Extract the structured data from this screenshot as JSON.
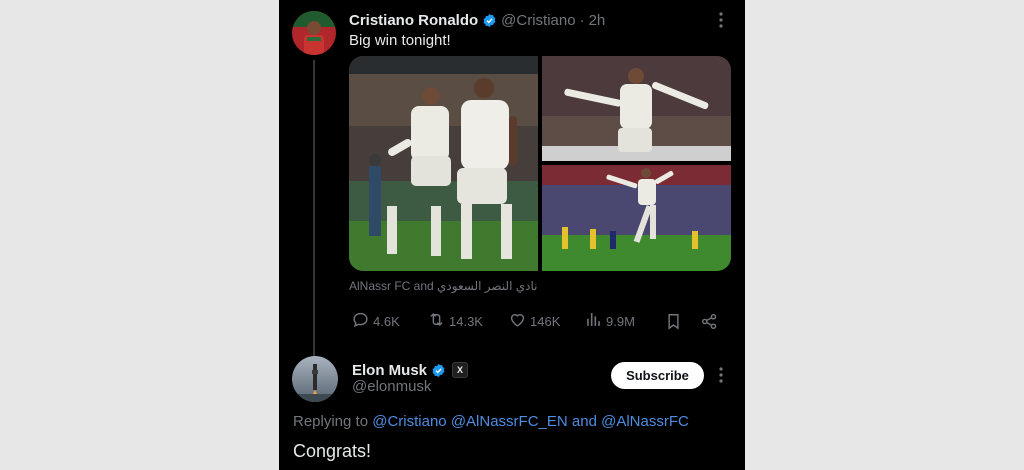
{
  "tweet": {
    "author_name": "Cristiano Ronaldo",
    "author_handle": "@Cristiano",
    "separator": "·",
    "time": "2h",
    "text": "Big win tonight!",
    "tagged": "AlNassr FC and نادي النصر السعودي",
    "stats": {
      "replies": "4.6K",
      "reposts": "14.3K",
      "likes": "146K",
      "views": "9.9M"
    }
  },
  "reply": {
    "author_name": "Elon Musk",
    "author_handle": "@elonmusk",
    "affiliate_badge": "X",
    "subscribe_label": "Subscribe",
    "replying_prefix": "Replying to",
    "mention_1": "@Cristiano",
    "mention_2": "@AlNassrFC_EN",
    "and_word": "and",
    "mention_3": "@AlNassrFC",
    "text": "Congrats!"
  },
  "colors": {
    "background": "#000000",
    "outer_background": "#e7e7e7",
    "text_primary": "#e7e9ea",
    "text_secondary": "#71767b",
    "verified_badge": "#1d9bf0",
    "mention_link": "#4e8de0"
  },
  "icons": [
    "more-icon",
    "verified-badge-icon",
    "reply-icon",
    "repost-icon",
    "like-icon",
    "views-icon",
    "bookmark-icon",
    "share-icon"
  ]
}
